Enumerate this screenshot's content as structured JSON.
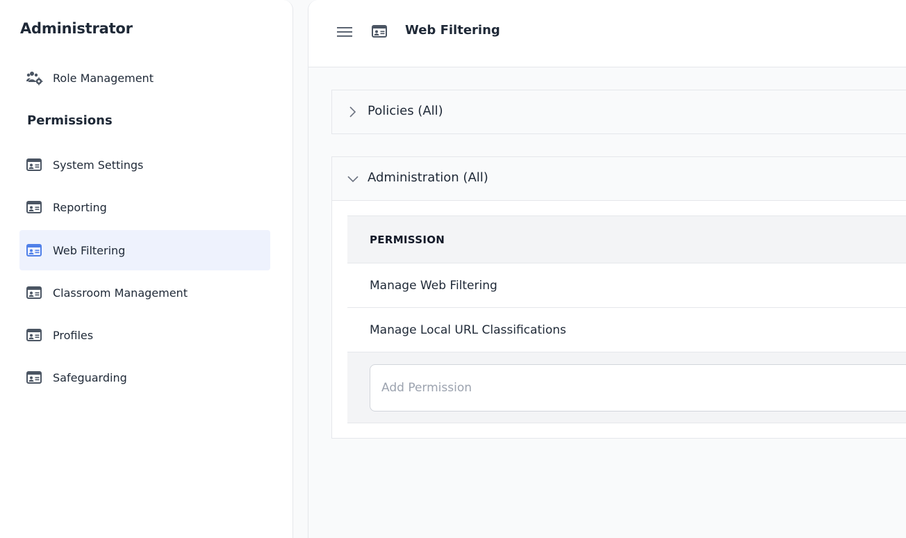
{
  "sidebar": {
    "title": "Administrator",
    "role_management": {
      "label": "Role Management",
      "icon": "users-cog-icon"
    },
    "section_title": "Permissions",
    "items": [
      {
        "label": "System Settings",
        "icon": "id-card-icon"
      },
      {
        "label": "Reporting",
        "icon": "id-card-icon"
      },
      {
        "label": "Web Filtering",
        "icon": "id-card-icon",
        "active": true
      },
      {
        "label": "Classroom Management",
        "icon": "id-card-icon"
      },
      {
        "label": "Profiles",
        "icon": "id-card-icon"
      },
      {
        "label": "Safeguarding",
        "icon": "id-card-icon"
      }
    ]
  },
  "header": {
    "menu_icon": "hamburger-icon",
    "page_icon": "id-card-icon",
    "title": "Web Filtering"
  },
  "panels": {
    "policies": {
      "title": "Policies (All)",
      "expanded": false
    },
    "administration": {
      "title": "Administration (All)",
      "expanded": true,
      "table": {
        "column_header": "PERMISSION",
        "rows": [
          "Manage Web Filtering",
          "Manage Local URL Classifications"
        ]
      },
      "add_placeholder": "Add Permission"
    }
  },
  "colors": {
    "active_bg": "#eef2fd",
    "active_icon": "#4f7fe8",
    "icon_gray": "#4b5563",
    "text": "#1f2937",
    "border": "#e5e7eb"
  }
}
